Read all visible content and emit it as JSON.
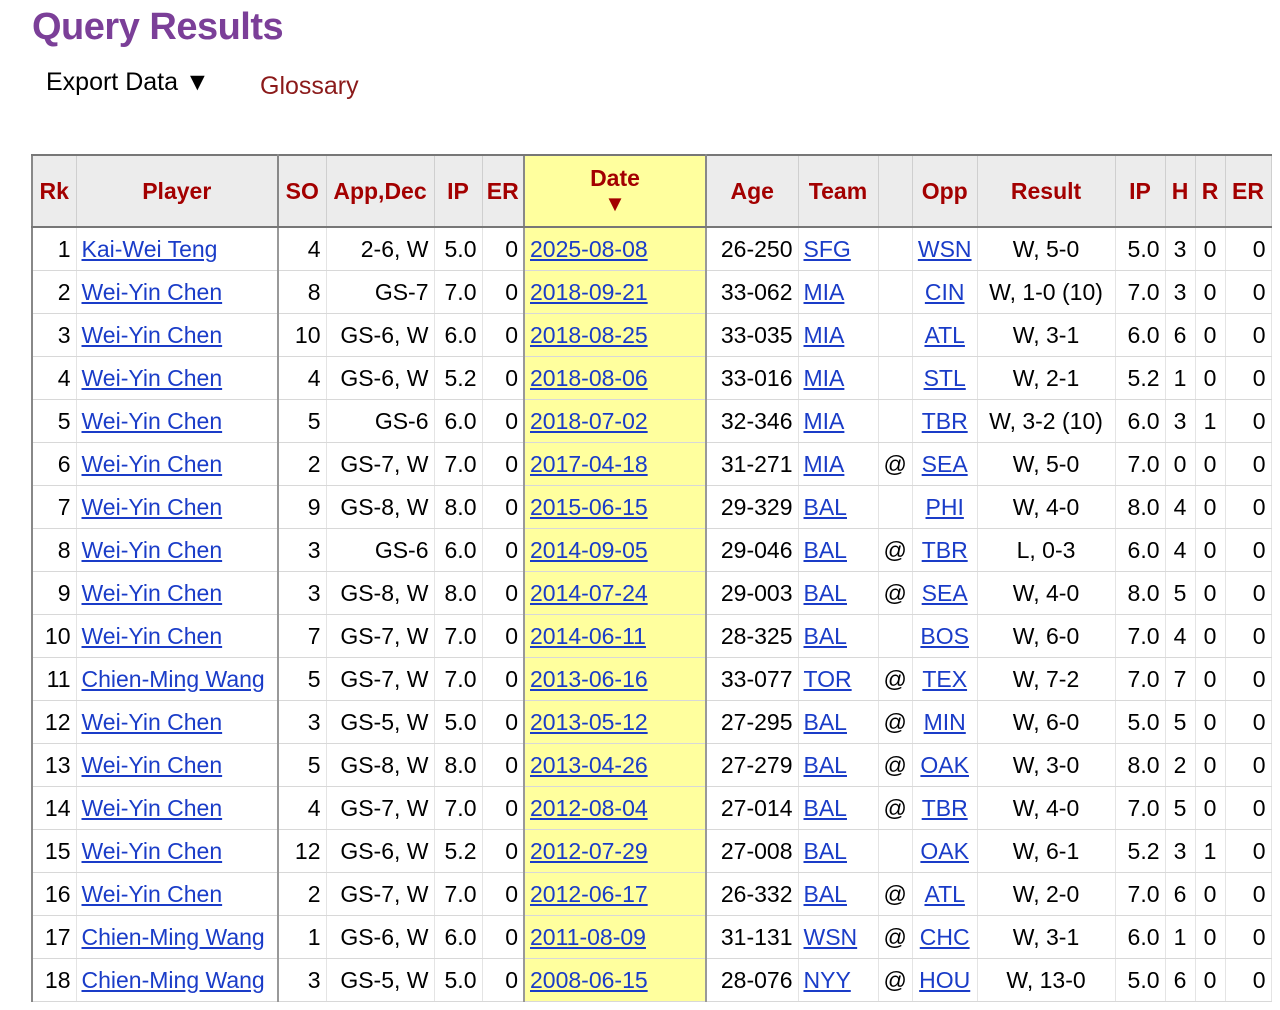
{
  "header": {
    "title": "Query Results",
    "export_label": "Export Data ▼",
    "glossary_label": "Glossary"
  },
  "table": {
    "columns": [
      "Rk",
      "Player",
      "SO",
      "App,Dec",
      "IP",
      "ER",
      "Date",
      "Age",
      "Team",
      "",
      "Opp",
      "Result",
      "IP",
      "H",
      "R",
      "ER"
    ],
    "sort_arrow": "▼",
    "rows": [
      {
        "rk": "1",
        "player": "Kai-Wei Teng",
        "so": "4",
        "app": "2-6, W",
        "ip": "5.0",
        "er": "0",
        "date": "2025-08-08",
        "age": "26-250",
        "team": "SFG",
        "at": "",
        "opp": "WSN",
        "result": "W, 5-0",
        "ip2": "5.0",
        "h": "3",
        "r": "0",
        "er2": "0"
      },
      {
        "rk": "2",
        "player": "Wei-Yin Chen",
        "so": "8",
        "app": "GS-7",
        "ip": "7.0",
        "er": "0",
        "date": "2018-09-21",
        "age": "33-062",
        "team": "MIA",
        "at": "",
        "opp": "CIN",
        "result": "W, 1-0 (10)",
        "ip2": "7.0",
        "h": "3",
        "r": "0",
        "er2": "0"
      },
      {
        "rk": "3",
        "player": "Wei-Yin Chen",
        "so": "10",
        "app": "GS-6, W",
        "ip": "6.0",
        "er": "0",
        "date": "2018-08-25",
        "age": "33-035",
        "team": "MIA",
        "at": "",
        "opp": "ATL",
        "result": "W, 3-1",
        "ip2": "6.0",
        "h": "6",
        "r": "0",
        "er2": "0"
      },
      {
        "rk": "4",
        "player": "Wei-Yin Chen",
        "so": "4",
        "app": "GS-6, W",
        "ip": "5.2",
        "er": "0",
        "date": "2018-08-06",
        "age": "33-016",
        "team": "MIA",
        "at": "",
        "opp": "STL",
        "result": "W, 2-1",
        "ip2": "5.2",
        "h": "1",
        "r": "0",
        "er2": "0"
      },
      {
        "rk": "5",
        "player": "Wei-Yin Chen",
        "so": "5",
        "app": "GS-6",
        "ip": "6.0",
        "er": "0",
        "date": "2018-07-02",
        "age": "32-346",
        "team": "MIA",
        "at": "",
        "opp": "TBR",
        "result": "W, 3-2 (10)",
        "ip2": "6.0",
        "h": "3",
        "r": "1",
        "er2": "0"
      },
      {
        "rk": "6",
        "player": "Wei-Yin Chen",
        "so": "2",
        "app": "GS-7, W",
        "ip": "7.0",
        "er": "0",
        "date": "2017-04-18",
        "age": "31-271",
        "team": "MIA",
        "at": "@",
        "opp": "SEA",
        "result": "W, 5-0",
        "ip2": "7.0",
        "h": "0",
        "r": "0",
        "er2": "0"
      },
      {
        "rk": "7",
        "player": "Wei-Yin Chen",
        "so": "9",
        "app": "GS-8, W",
        "ip": "8.0",
        "er": "0",
        "date": "2015-06-15",
        "age": "29-329",
        "team": "BAL",
        "at": "",
        "opp": "PHI",
        "result": "W, 4-0",
        "ip2": "8.0",
        "h": "4",
        "r": "0",
        "er2": "0"
      },
      {
        "rk": "8",
        "player": "Wei-Yin Chen",
        "so": "3",
        "app": "GS-6",
        "ip": "6.0",
        "er": "0",
        "date": "2014-09-05",
        "age": "29-046",
        "team": "BAL",
        "at": "@",
        "opp": "TBR",
        "result": "L, 0-3",
        "ip2": "6.0",
        "h": "4",
        "r": "0",
        "er2": "0"
      },
      {
        "rk": "9",
        "player": "Wei-Yin Chen",
        "so": "3",
        "app": "GS-8, W",
        "ip": "8.0",
        "er": "0",
        "date": "2014-07-24",
        "age": "29-003",
        "team": "BAL",
        "at": "@",
        "opp": "SEA",
        "result": "W, 4-0",
        "ip2": "8.0",
        "h": "5",
        "r": "0",
        "er2": "0"
      },
      {
        "rk": "10",
        "player": "Wei-Yin Chen",
        "so": "7",
        "app": "GS-7, W",
        "ip": "7.0",
        "er": "0",
        "date": "2014-06-11",
        "age": "28-325",
        "team": "BAL",
        "at": "",
        "opp": "BOS",
        "result": "W, 6-0",
        "ip2": "7.0",
        "h": "4",
        "r": "0",
        "er2": "0"
      },
      {
        "rk": "11",
        "player": "Chien-Ming Wang",
        "so": "5",
        "app": "GS-7, W",
        "ip": "7.0",
        "er": "0",
        "date": "2013-06-16",
        "age": "33-077",
        "team": "TOR",
        "at": "@",
        "opp": "TEX",
        "result": "W, 7-2",
        "ip2": "7.0",
        "h": "7",
        "r": "0",
        "er2": "0"
      },
      {
        "rk": "12",
        "player": "Wei-Yin Chen",
        "so": "3",
        "app": "GS-5, W",
        "ip": "5.0",
        "er": "0",
        "date": "2013-05-12",
        "age": "27-295",
        "team": "BAL",
        "at": "@",
        "opp": "MIN",
        "result": "W, 6-0",
        "ip2": "5.0",
        "h": "5",
        "r": "0",
        "er2": "0"
      },
      {
        "rk": "13",
        "player": "Wei-Yin Chen",
        "so": "5",
        "app": "GS-8, W",
        "ip": "8.0",
        "er": "0",
        "date": "2013-04-26",
        "age": "27-279",
        "team": "BAL",
        "at": "@",
        "opp": "OAK",
        "result": "W, 3-0",
        "ip2": "8.0",
        "h": "2",
        "r": "0",
        "er2": "0"
      },
      {
        "rk": "14",
        "player": "Wei-Yin Chen",
        "so": "4",
        "app": "GS-7, W",
        "ip": "7.0",
        "er": "0",
        "date": "2012-08-04",
        "age": "27-014",
        "team": "BAL",
        "at": "@",
        "opp": "TBR",
        "result": "W, 4-0",
        "ip2": "7.0",
        "h": "5",
        "r": "0",
        "er2": "0"
      },
      {
        "rk": "15",
        "player": "Wei-Yin Chen",
        "so": "12",
        "app": "GS-6, W",
        "ip": "5.2",
        "er": "0",
        "date": "2012-07-29",
        "age": "27-008",
        "team": "BAL",
        "at": "",
        "opp": "OAK",
        "result": "W, 6-1",
        "ip2": "5.2",
        "h": "3",
        "r": "1",
        "er2": "0"
      },
      {
        "rk": "16",
        "player": "Wei-Yin Chen",
        "so": "2",
        "app": "GS-7, W",
        "ip": "7.0",
        "er": "0",
        "date": "2012-06-17",
        "age": "26-332",
        "team": "BAL",
        "at": "@",
        "opp": "ATL",
        "result": "W, 2-0",
        "ip2": "7.0",
        "h": "6",
        "r": "0",
        "er2": "0"
      },
      {
        "rk": "17",
        "player": "Chien-Ming Wang",
        "so": "1",
        "app": "GS-6, W",
        "ip": "6.0",
        "er": "0",
        "date": "2011-08-09",
        "age": "31-131",
        "team": "WSN",
        "at": "@",
        "opp": "CHC",
        "result": "W, 3-1",
        "ip2": "6.0",
        "h": "1",
        "r": "0",
        "er2": "0"
      },
      {
        "rk": "18",
        "player": "Chien-Ming Wang",
        "so": "3",
        "app": "GS-5, W",
        "ip": "5.0",
        "er": "0",
        "date": "2008-06-15",
        "age": "28-076",
        "team": "NYY",
        "at": "@",
        "opp": "HOU",
        "result": "W, 13-0",
        "ip2": "5.0",
        "h": "6",
        "r": "0",
        "er2": "0"
      }
    ]
  }
}
